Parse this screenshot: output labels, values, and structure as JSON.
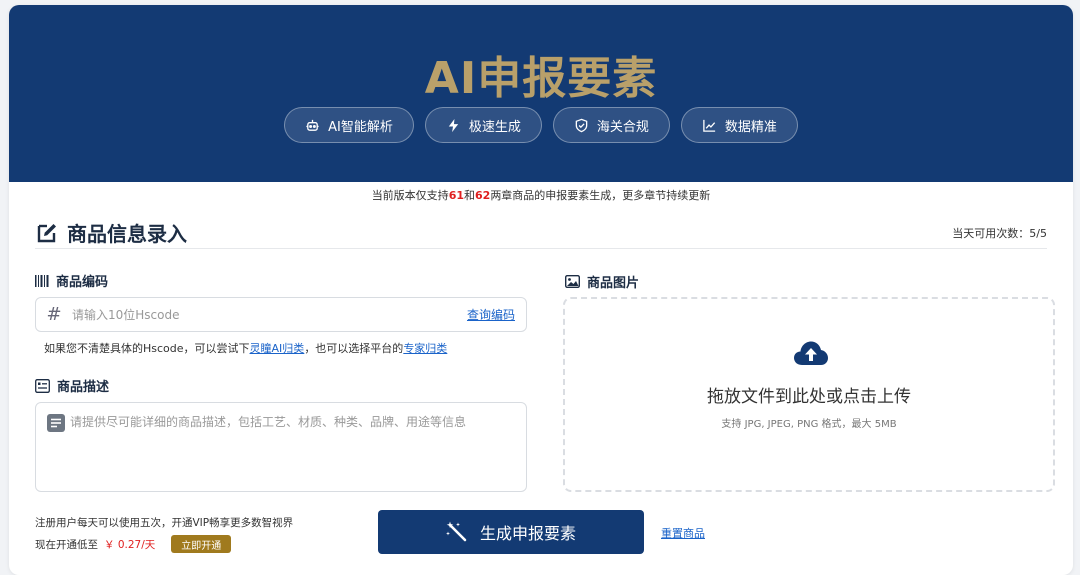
{
  "hero": {
    "title": "AI申报要素",
    "pills": [
      {
        "label": "AI智能解析",
        "icon": "robot-icon"
      },
      {
        "label": "极速生成",
        "icon": "lightning-icon"
      },
      {
        "label": "海关合规",
        "icon": "shield-icon"
      },
      {
        "label": "数据精准",
        "icon": "chart-line-icon"
      }
    ]
  },
  "notice": {
    "prefix": "当前版本仅支持",
    "ch1": "61",
    "mid": "和",
    "ch2": "62",
    "suffix": "两章商品的申报要素生成，更多章节持续更新"
  },
  "section": {
    "title": "商品信息录入",
    "icon": "edit-icon",
    "usage": "当天可用次数：5/5"
  },
  "hscode": {
    "label": "商品编码",
    "icon": "barcode-icon",
    "placeholder": "请输入10位Hscode",
    "query_link": "查询编码",
    "hint_prefix": "如果您不清楚具体的Hscode，可以尝试下",
    "hint_link1": "灵瞳AI归类",
    "hint_mid": "，也可以选择平台的",
    "hint_link2": "专家归类"
  },
  "description": {
    "label": "商品描述",
    "icon": "list-icon",
    "placeholder": "请提供尽可能详细的商品描述，包括工艺、材质、种类、品牌、用途等信息"
  },
  "image": {
    "label": "商品图片",
    "icon": "image-icon",
    "upload_text": "拖放文件到此处或点击上传",
    "upload_sub": "支持 JPG, JPEG, PNG 格式，最大 5MB"
  },
  "footer": {
    "register_text": "注册用户每天可以使用五次，开通VIP畅享更多数智视界",
    "price_prefix": "现在开通低至",
    "price": "￥ 0.27/天",
    "open_button": "立即开通",
    "generate_button": "生成申报要素",
    "reset_link": "重置商品"
  },
  "colors": {
    "brand": "#133a73",
    "gold": "#b9a06a",
    "link": "#1a63c9",
    "highlight": "#e02020"
  }
}
